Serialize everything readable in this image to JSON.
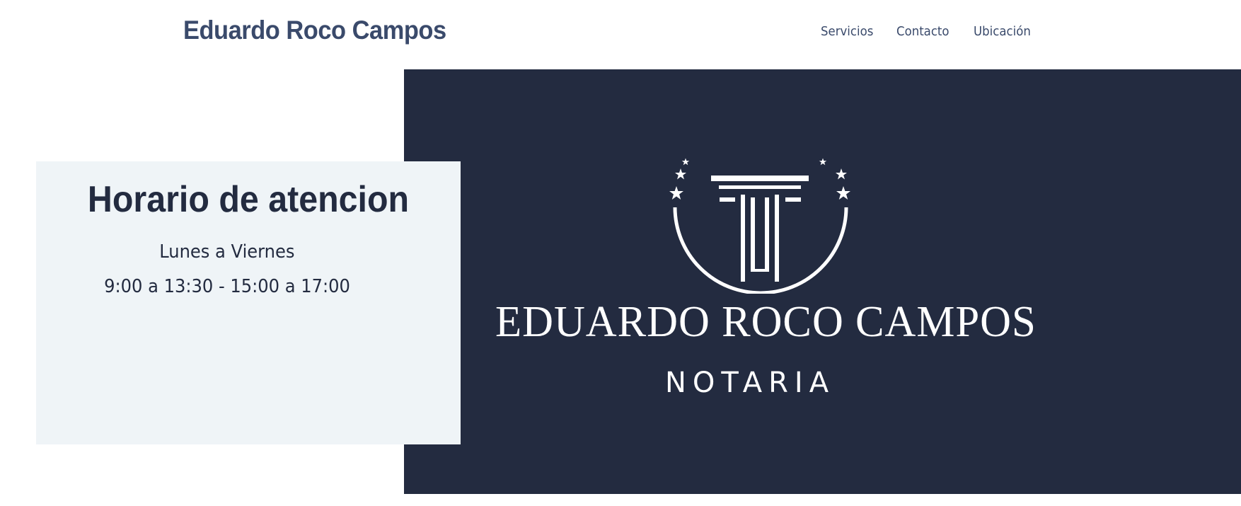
{
  "header": {
    "site_title": "Eduardo Roco Campos",
    "nav": [
      {
        "label": "Servicios"
      },
      {
        "label": "Contacto"
      },
      {
        "label": "Ubicación"
      }
    ]
  },
  "hours": {
    "title": "Horario de atencion",
    "days": "Lunes a Viernes",
    "times": "9:00 a 13:30 - 15:00 a 17:00"
  },
  "hero": {
    "brand_name": "EDUARDO ROCO CAMPOS",
    "brand_sub": "NOTARIA",
    "logo_icon": "column-with-stars-icon"
  },
  "colors": {
    "navy": "#232b40",
    "title_blue": "#3a4a6b",
    "card_bg": "#eff4f7"
  }
}
